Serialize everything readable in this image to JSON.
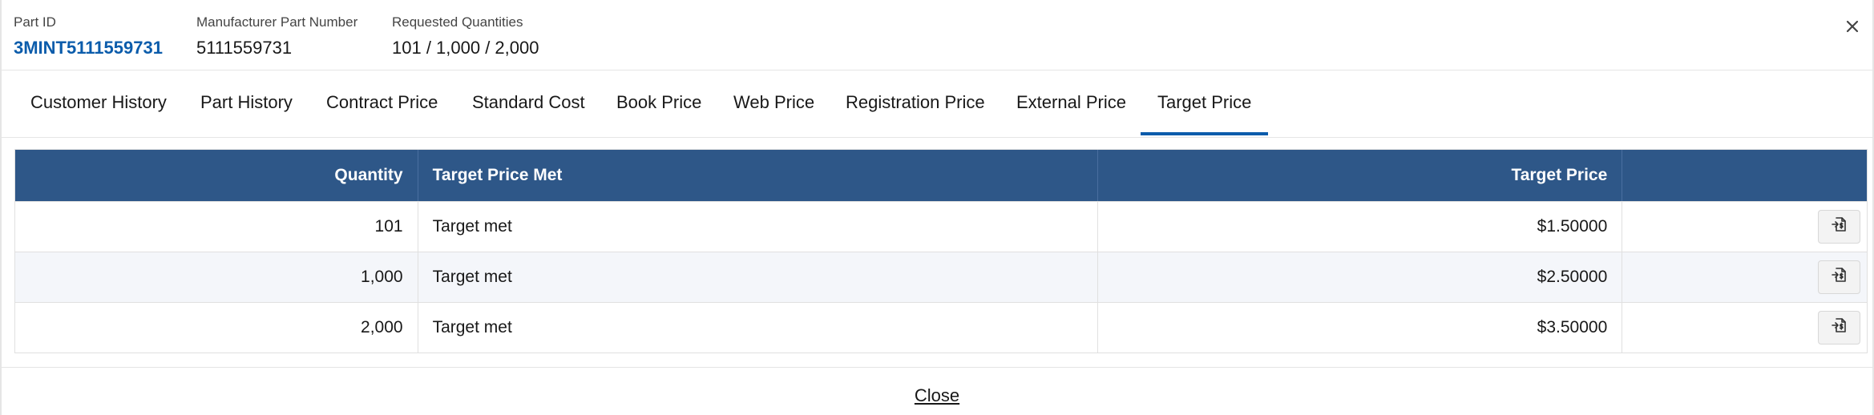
{
  "header": {
    "part_id_label": "Part ID",
    "part_id": "3MINT5111559731",
    "mpn_label": "Manufacturer Part Number",
    "mpn": "5111559731",
    "qty_label": "Requested Quantities",
    "qty": "101 / 1,000 / 2,000"
  },
  "tabs": [
    {
      "label": "Customer History"
    },
    {
      "label": "Part History"
    },
    {
      "label": "Contract Price"
    },
    {
      "label": "Standard Cost"
    },
    {
      "label": "Book Price"
    },
    {
      "label": "Web Price"
    },
    {
      "label": "Registration Price"
    },
    {
      "label": "External Price"
    },
    {
      "label": "Target Price",
      "active": true
    }
  ],
  "table": {
    "headers": [
      "Quantity",
      "Target Price Met",
      "Target Price"
    ],
    "rows": [
      {
        "quantity": "101",
        "met": "Target met",
        "price": "$1.50000"
      },
      {
        "quantity": "1,000",
        "met": "Target met",
        "price": "$2.50000"
      },
      {
        "quantity": "2,000",
        "met": "Target met",
        "price": "$3.50000"
      }
    ]
  },
  "footer": {
    "close_label": "Close"
  },
  "colors": {
    "accent": "#0b5cab",
    "table_header": "#2e5788"
  }
}
